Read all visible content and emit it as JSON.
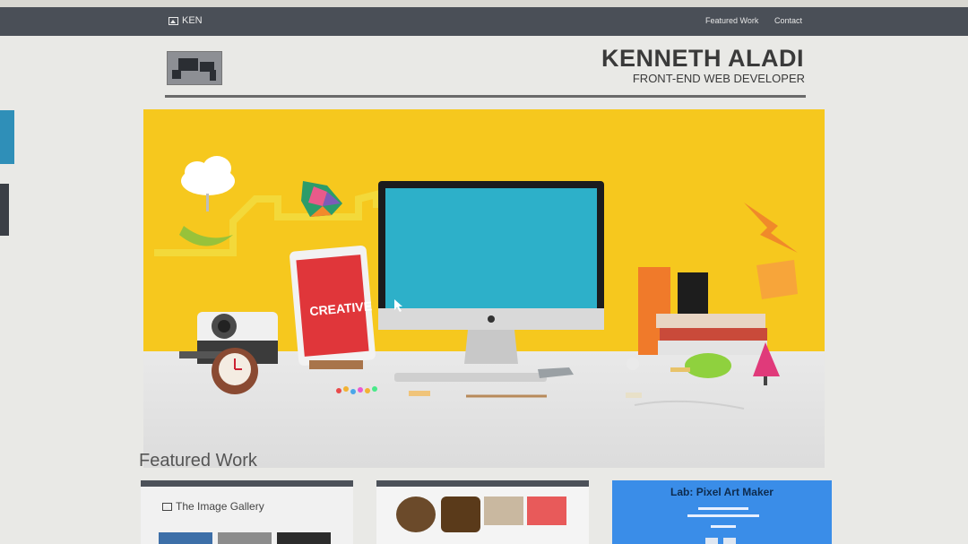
{
  "nav": {
    "brand": "KEN",
    "links": [
      "Featured Work",
      "Contact"
    ]
  },
  "header": {
    "name": "KENNETH ALADI",
    "subtitle": "FRONT-END WEB DEVELOPER"
  },
  "hero": {
    "tablet_text": "CREATIVE"
  },
  "featured": {
    "title": "Featured Work",
    "cards": [
      {
        "title": "The Image Gallery"
      },
      {
        "title": ""
      },
      {
        "title": "Lab: Pixel Art Maker"
      }
    ]
  },
  "colors": {
    "navbar": "#4a4f57",
    "hero_wall": "#f6c81e",
    "pixel_card": "#3a8de8"
  }
}
